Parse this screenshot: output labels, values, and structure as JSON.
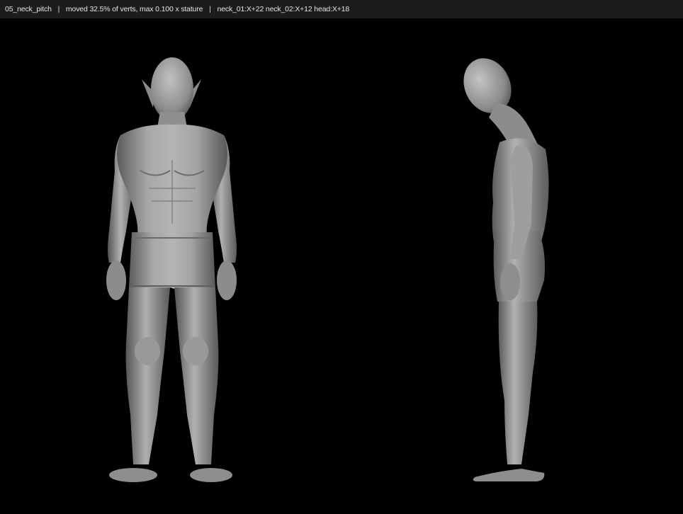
{
  "status": {
    "pose_name": "05_neck_pitch",
    "separator": "|",
    "moved_stat": "moved 32.5% of verts, max 0.100 x stature",
    "joints": "neck_01:X+22 neck_02:X+12 head:X+18"
  },
  "views": {
    "front": {
      "icon": "human-figure-front-view"
    },
    "side": {
      "icon": "human-figure-side-view"
    }
  },
  "colors": {
    "background": "#000000",
    "status_bar": "#1c1c1e",
    "status_text": "#e4e4e4",
    "mesh": "#9a9a9a"
  }
}
